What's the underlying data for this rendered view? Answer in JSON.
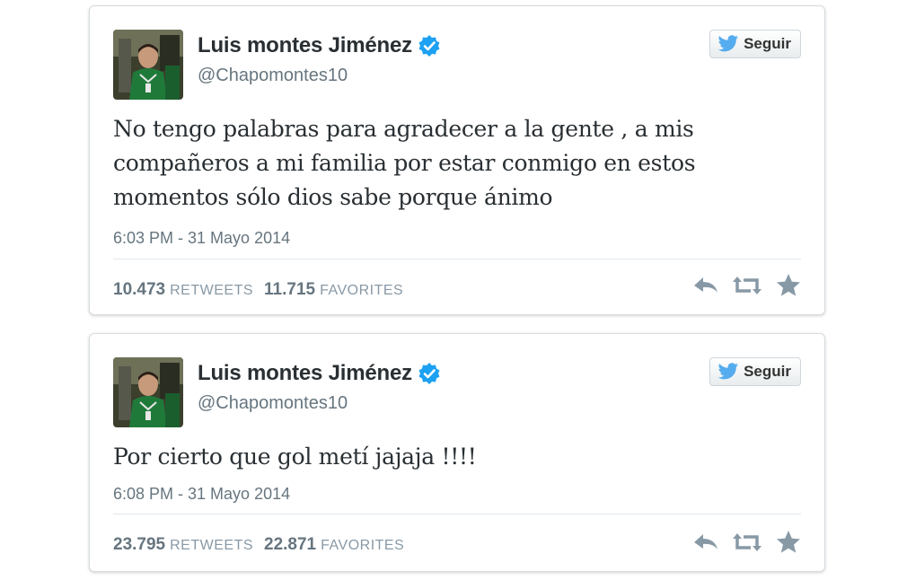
{
  "colors": {
    "verified_badge": "#1da1f2",
    "twitter_blue": "#55acee",
    "text_primary": "#292f33",
    "text_secondary": "#66757f",
    "action_icon": "#8899a6"
  },
  "icons": {
    "verified": "verified-badge-icon",
    "follow": "twitter-bird-icon",
    "reply": "reply-icon",
    "retweet": "retweet-icon",
    "favorite": "star-icon"
  },
  "tweets": [
    {
      "author": {
        "name": "Luis montes Jiménez",
        "handle": "@Chapomontes10"
      },
      "follow_label": "Seguir",
      "text": "No tengo palabras para agradecer a la gente , a mis compañeros a mi familia por estar conmigo en estos momentos sólo dios sabe porque ánimo",
      "timestamp": "6:03 PM - 31 Mayo 2014",
      "retweets": "10.473",
      "retweets_label": "RETWEETS",
      "favorites": "11.715",
      "favorites_label": "FAVORITES"
    },
    {
      "author": {
        "name": "Luis montes Jiménez",
        "handle": "@Chapomontes10"
      },
      "follow_label": "Seguir",
      "text": "Por cierto que gol metí jajaja !!!!",
      "timestamp": "6:08 PM - 31 Mayo 2014",
      "retweets": "23.795",
      "retweets_label": "RETWEETS",
      "favorites": "22.871",
      "favorites_label": "FAVORITES"
    }
  ]
}
